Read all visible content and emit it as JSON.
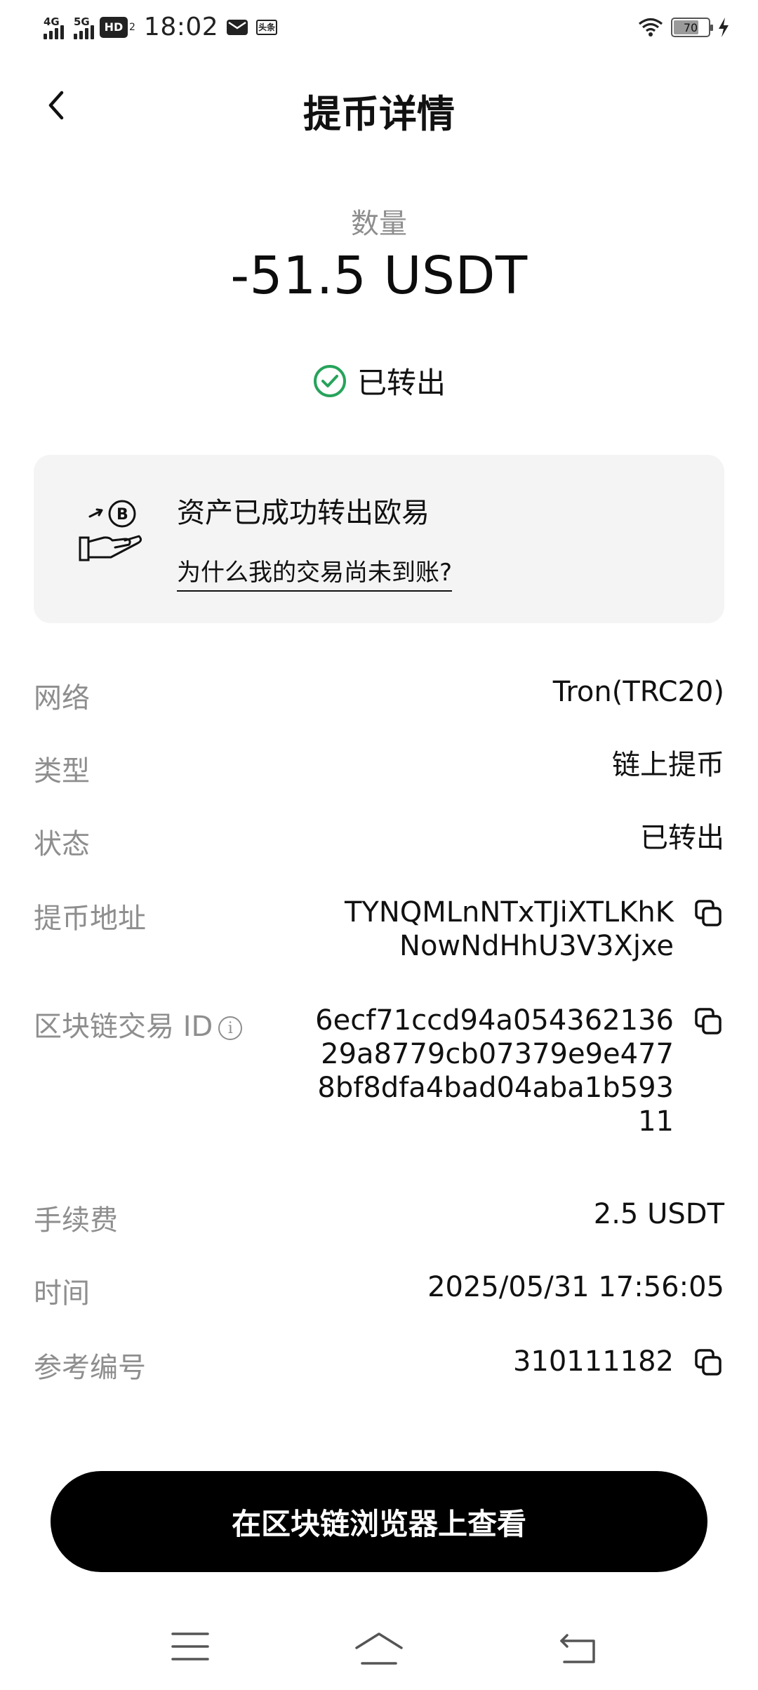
{
  "status_bar": {
    "net1": "4G",
    "net2": "5G",
    "hd": "HD",
    "hd_sub": "2",
    "time": "18:02",
    "news_badge": "头条",
    "battery": "70",
    "icons": [
      "signal-icon",
      "mail-icon",
      "wifi-icon",
      "battery-icon",
      "charging-icon"
    ]
  },
  "header": {
    "title": "提币详情",
    "back_icon": "chevron-left-icon"
  },
  "amount": {
    "label": "数量",
    "value": "-51.5 USDT",
    "status": "已转出",
    "status_color": "#27a35b"
  },
  "notice": {
    "message": "资产已成功转出欧易",
    "link": "为什么我的交易尚未到账?"
  },
  "details": {
    "network": {
      "label": "网络",
      "value": "Tron(TRC20)"
    },
    "type": {
      "label": "类型",
      "value": "链上提币"
    },
    "status": {
      "label": "状态",
      "value": "已转出"
    },
    "address": {
      "label": "提币地址",
      "line1": "TYNQMLnNTxTJiXTLKhK",
      "line2": "NowNdHhU3V3Xjxe"
    },
    "txid": {
      "label": "区块链交易 ID",
      "line1": "6ecf71ccd94a054362136",
      "line2": "29a8779cb07379e9e477",
      "line3": "8bf8dfa4bad04aba1b593",
      "line4": "11"
    },
    "fee": {
      "label": "手续费",
      "value": "2.5 USDT"
    },
    "time": {
      "label": "时间",
      "value": "2025/05/31 17:56:05"
    },
    "ref": {
      "label": "参考编号",
      "value": "310111182"
    }
  },
  "action": {
    "label": "在区块链浏览器上查看"
  },
  "navbar": {
    "icons": [
      "menu-icon",
      "home-icon",
      "back-icon"
    ]
  }
}
